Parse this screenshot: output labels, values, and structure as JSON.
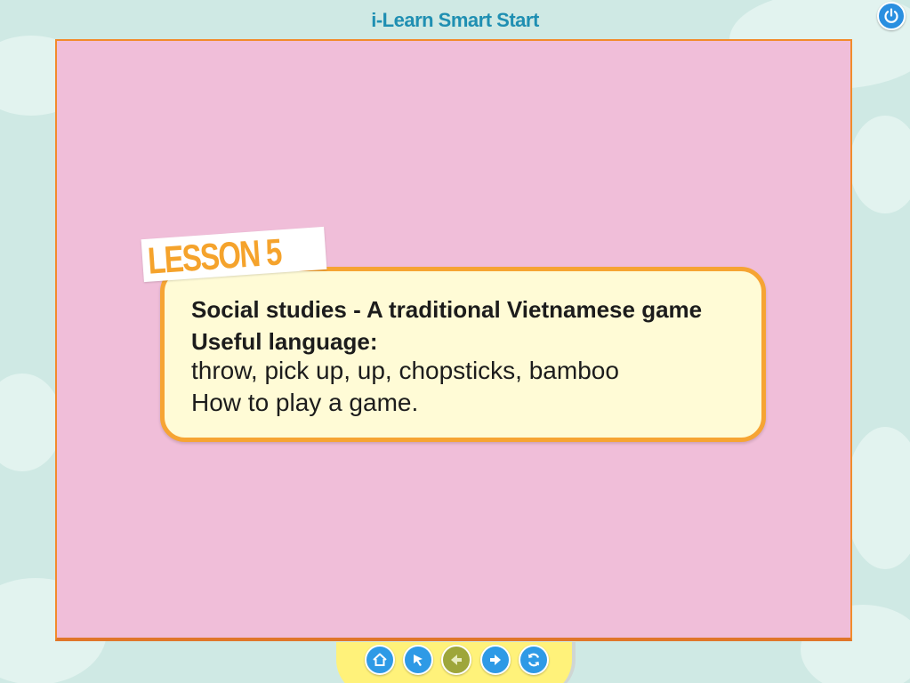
{
  "app": {
    "title": "i-Learn Smart Start"
  },
  "lesson": {
    "badge": "LESSON 5",
    "topic": "Social studies - A traditional Vietnamese game",
    "useful_language_heading": "Useful language:",
    "vocabulary": "throw, pick up, up, chopsticks, bamboo",
    "objective": "How to play a game."
  },
  "toolbar": {
    "buttons": [
      {
        "icon": "home-icon",
        "enabled": true
      },
      {
        "icon": "pointer-icon",
        "enabled": true
      },
      {
        "icon": "back-arrow-icon",
        "enabled": false
      },
      {
        "icon": "forward-arrow-icon",
        "enabled": true
      },
      {
        "icon": "refresh-icon",
        "enabled": true
      }
    ]
  },
  "colors": {
    "background": "#cfe9e4",
    "stage": "#f0bed9",
    "stage_border": "#f28b2b",
    "card": "#fffbd6",
    "card_border": "#f6a433",
    "title": "#1f8fb2",
    "badge_text": "#f5a32c",
    "nav_bar": "#fff27a",
    "button_blue": "#2e9ae6",
    "button_disabled": "#9ea63a"
  }
}
